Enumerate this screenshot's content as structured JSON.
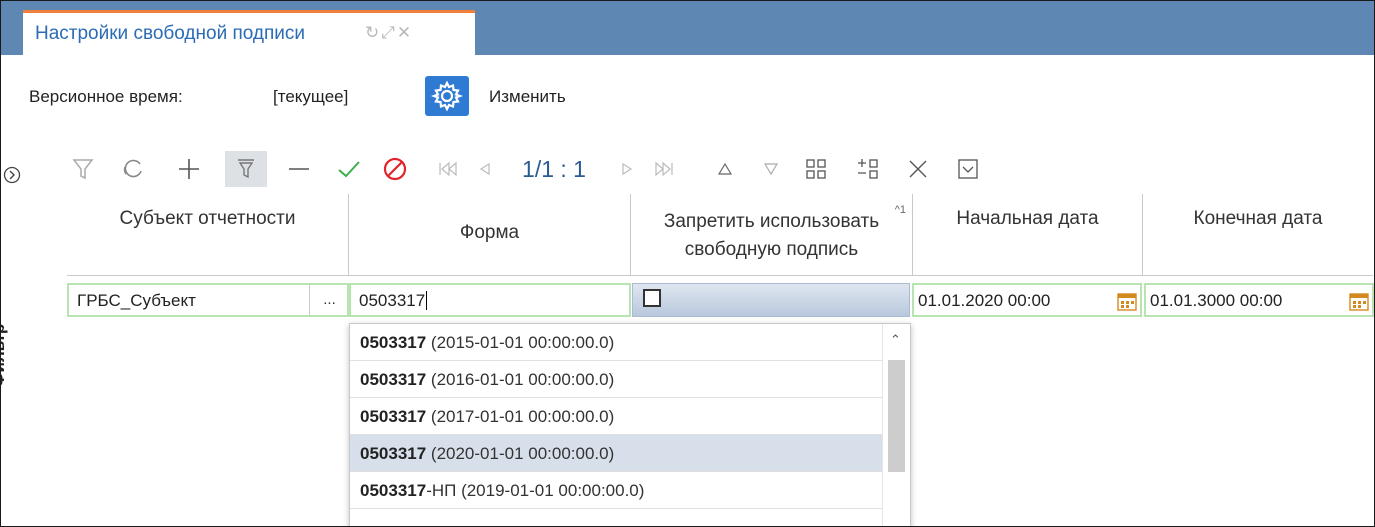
{
  "tab": {
    "title": "Настройки свободной подписи"
  },
  "version": {
    "label": "Версионное время:",
    "value": "[текущее]",
    "change_label": "Изменить"
  },
  "filter": {
    "label": "Фильтр"
  },
  "pager": {
    "text": "1/1 : 1"
  },
  "grid": {
    "headers": [
      {
        "text": "Субъект отчетности"
      },
      {
        "text": "Форма"
      },
      {
        "line1": "Запретить использовать",
        "line2": "свободную подпись",
        "sort_mark": "^1"
      },
      {
        "text": "Начальная дата"
      },
      {
        "text": "Конечная дата"
      }
    ],
    "row": {
      "subject": "ГРБС_Субъект",
      "ellipsis": "...",
      "form": "0503317",
      "start_date": "01.01.2020 00:00",
      "end_date": "01.01.3000 00:00"
    }
  },
  "dropdown": {
    "items": [
      {
        "code": "0503317",
        "suffix": " (2015-01-01 00:00:00.0)"
      },
      {
        "code": "0503317",
        "suffix": " (2016-01-01 00:00:00.0)"
      },
      {
        "code": "0503317",
        "suffix": " (2017-01-01 00:00:00.0)"
      },
      {
        "code": "0503317",
        "suffix": " (2020-01-01 00:00:00.0)"
      },
      {
        "code": "0503317",
        "suffix": "-НП (2019-01-01 00:00:00.0)"
      }
    ],
    "selected_index": 3
  },
  "colors": {
    "accent": "#5f87b4",
    "tab_border": "#f07f3c",
    "ok_green": "#3cb04a",
    "cancel_red": "#e0262c",
    "row_border": "#b7e4b0"
  }
}
